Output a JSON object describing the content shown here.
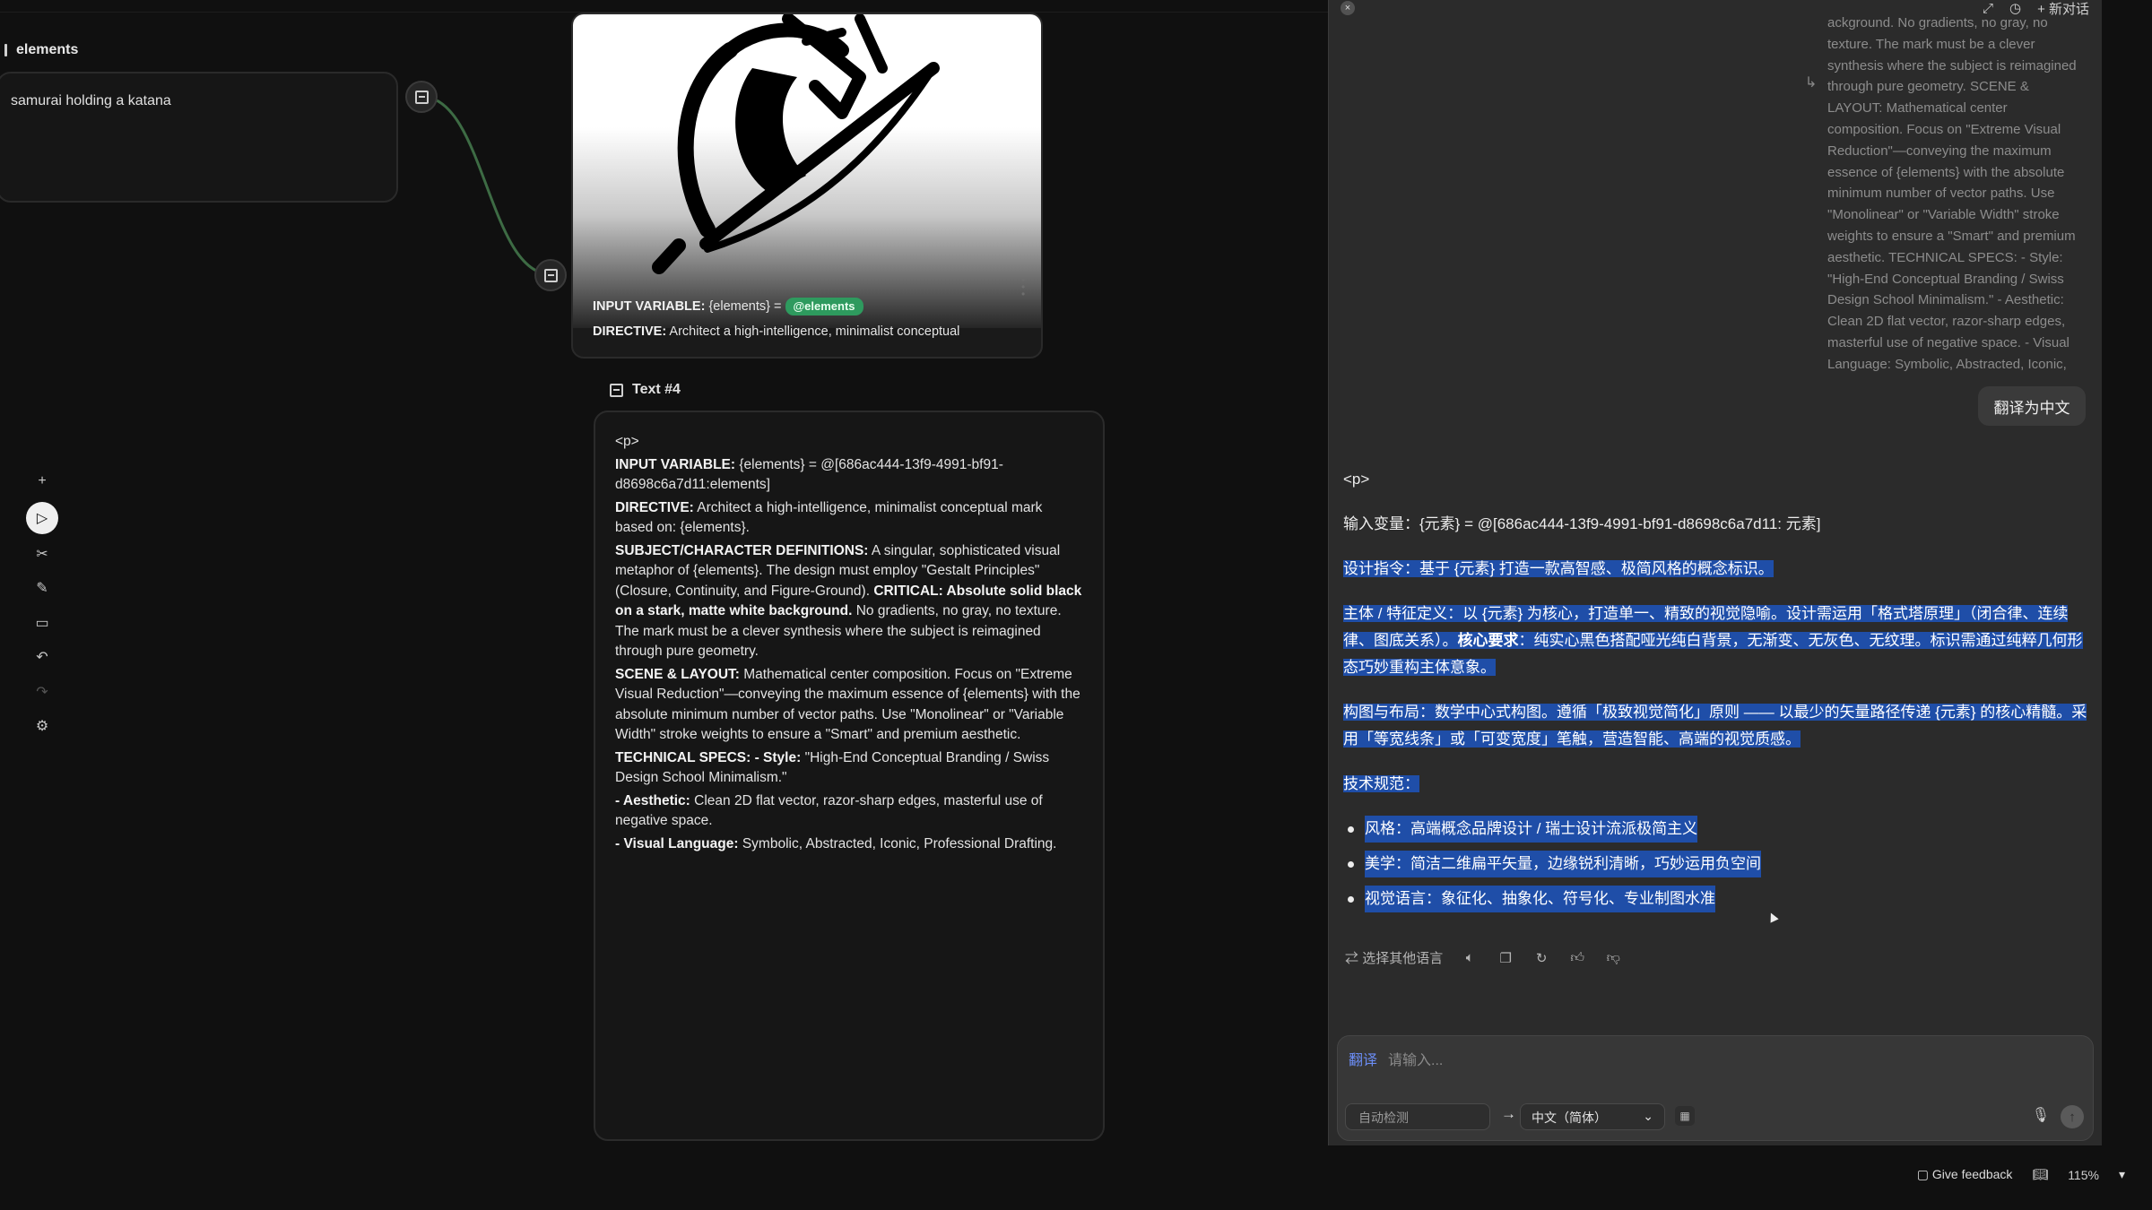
{
  "canvas": {
    "elements_node": {
      "label": "elements",
      "value": "samurai holding a katana"
    },
    "image_card": {
      "input_var_label": "INPUT VARIABLE:",
      "input_var_value": "{elements} =",
      "pill": "@elements",
      "directive_label": "DIRECTIVE:",
      "directive_text": "Architect a high-intelligence, minimalist conceptual"
    },
    "text_node": {
      "title": "Text #4",
      "p_tag": "<p>",
      "l1_label": "INPUT VARIABLE:",
      "l1_text": "{elements} = @[686ac444-13f9-4991-bf91-d8698c6a7d11:elements]",
      "l2_label": "DIRECTIVE:",
      "l2_text": "Architect a high-intelligence, minimalist conceptual mark based on: {elements}.",
      "l3_label": "SUBJECT/CHARACTER DEFINITIONS:",
      "l3_text": "A singular, sophisticated visual metaphor of {elements}. The design must employ \"Gestalt Principles\" (Closure, Continuity, and Figure-Ground).",
      "l3_critical": "CRITICAL: Absolute solid black on a stark, matte white background.",
      "l3_tail": "No gradients, no gray, no texture. The mark must be a clever synthesis where the subject is reimagined through pure geometry.",
      "l4_label": "SCENE & LAYOUT:",
      "l4_text": "Mathematical center composition. Focus on \"Extreme Visual Reduction\"—conveying the maximum essence of {elements} with the absolute minimum number of vector paths. Use \"Monolinear\" or \"Variable Width\" stroke weights to ensure a \"Smart\" and premium aesthetic.",
      "l5_label": "TECHNICAL SPECS: - Style:",
      "l5_text": "\"High-End Conceptual Branding / Swiss Design School Minimalism.\"",
      "l6_label": "- Aesthetic:",
      "l6_text": "Clean 2D flat vector, razor-sharp edges, masterful use of negative space.",
      "l7_label": "- Visual Language:",
      "l7_text": "Symbolic, Abstracted, Iconic, Professional Drafting."
    },
    "toolbar": [
      "plus-icon",
      "pointer-icon",
      "scissors-icon",
      "pen-icon",
      "comment-icon",
      "undo-icon",
      "redo-icon",
      "settings-icon"
    ]
  },
  "panel": {
    "top": {
      "close": "×",
      "expand": "⤢",
      "history": "◷",
      "new_chat": "+ 新对话"
    },
    "source_text": "ackground. No gradients, no gray, no texture. The mark must be a clever synthesis where the subject is reimagined through pure geometry. SCENE & LAYOUT: Mathematical center composition. Focus on \"Extreme Visual Reduction\"—conveying the maximum essence of {elements} with the absolute minimum number of vector paths. Use \"Monolinear\" or \"Variable Width\" stroke weights to ensure a \"Smart\" and premium aesthetic. TECHNICAL SPECS: - Style: \"High-End Conceptual Branding / Swiss Design School Minimalism.\" - Aesthetic: Clean 2D flat vector, razor-sharp edges, masterful use of negative space. - Visual Language: Symbolic, Abstracted, Iconic, Professional Drafting.",
    "translate_btn": "翻译为中文",
    "result": {
      "p_tag": "<p>",
      "r1": "输入变量：{元素} = @[686ac444-13f9-4991-bf91-d8698c6a7d11: 元素]",
      "r2": "设计指令：基于 {元素} 打造一款高智感、极简风格的概念标识。",
      "r3a": "主体 / 特征定义：以 {元素} 为核心，打造单一、精致的视觉隐喻。设计需运用「格式塔原理」（闭合律、连续律、图底关系）。",
      "r3b": "核心要求",
      "r3c": "：纯实心黑色搭配哑光纯白背景，无渐变、无灰色、无纹理。标识需通过纯粹几何形态巧妙重构主体意象。",
      "r4": "构图与布局：数学中心式构图。遵循「极致视觉简化」原则 —— 以最少的矢量路径传递 {元素} 的核心精髓。采用「等宽线条」或「可变宽度」笔触，营造智能、高端的视觉质感。",
      "r5": "技术规范：",
      "bullets": [
        "风格：高端概念品牌设计 / 瑞士设计流派极简主义",
        "美学：简洁二维扁平矢量，边缘锐利清晰，巧妙运用负空间",
        "视觉语言：象征化、抽象化、符号化、专业制图水准"
      ]
    },
    "actions": {
      "other_lang": "选择其他语言"
    },
    "input": {
      "tag": "翻译",
      "placeholder": "请输入...",
      "src_lang": "自动检测",
      "dst_lang": "中文（简体）"
    }
  },
  "footer": {
    "feedback": "Give feedback",
    "zoom": "115%"
  }
}
